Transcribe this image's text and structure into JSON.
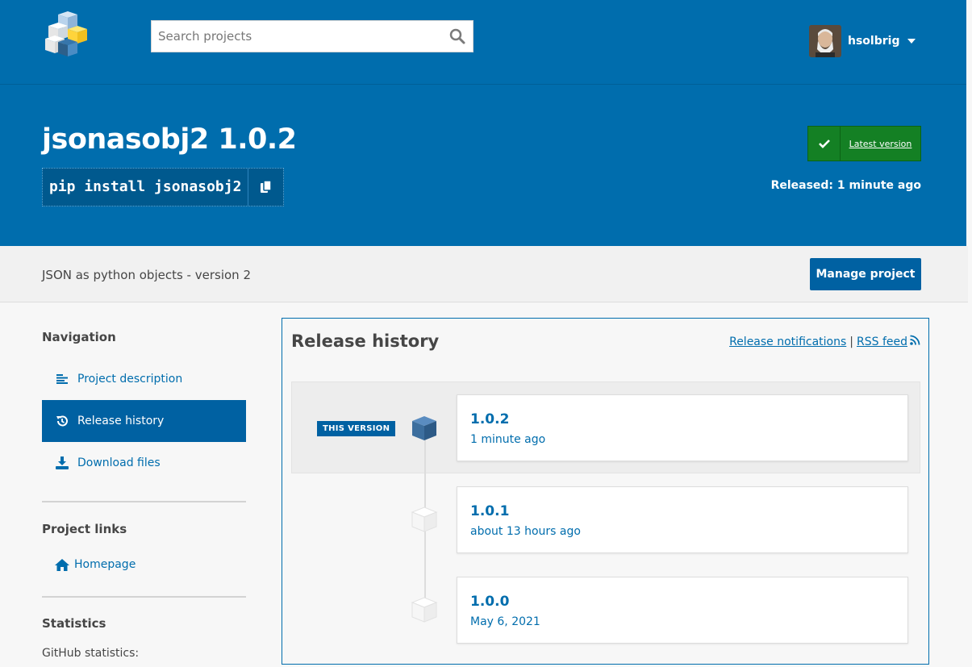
{
  "header": {
    "search": {
      "placeholder": "Search projects"
    },
    "user": {
      "name": "hsolbrig"
    }
  },
  "package": {
    "title": "jsonasobj2 1.0.2",
    "pip_command": "pip install jsonasobj2",
    "latest_label": "Latest version",
    "released": "Released: 1 minute ago",
    "summary": "JSON as python objects - version 2",
    "manage_label": "Manage project"
  },
  "sidebar": {
    "navigation_heading": "Navigation",
    "nav": [
      {
        "label": "Project description",
        "icon": "align-left-icon"
      },
      {
        "label": "Release history",
        "icon": "history-icon",
        "active": true
      },
      {
        "label": "Download files",
        "icon": "download-icon"
      }
    ],
    "links_heading": "Project links",
    "links": [
      {
        "label": "Homepage",
        "icon": "home-icon"
      }
    ],
    "stats_heading": "Statistics",
    "stats_text": "GitHub statistics:"
  },
  "history": {
    "title": "Release history",
    "notifications_label": "Release notifications",
    "separator": "|",
    "rss_label": "RSS feed",
    "this_version_label": "THIS VERSION",
    "releases": [
      {
        "version": "1.0.2",
        "when": "1 minute ago",
        "current": true
      },
      {
        "version": "1.0.1",
        "when": "about 13 hours ago",
        "current": false
      },
      {
        "version": "1.0.0",
        "when": "May 6, 2021",
        "current": false
      }
    ]
  },
  "colors": {
    "brand_blue": "#006dad",
    "active_blue": "#0061a2",
    "latest_green": "#148024"
  }
}
